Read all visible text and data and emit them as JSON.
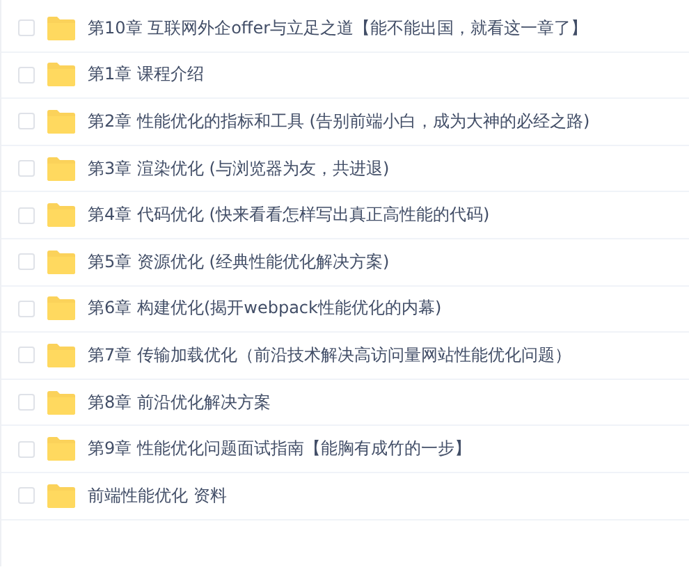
{
  "files": [
    {
      "name": "第10章 互联网外企offer与立足之道【能不能出国，就看这一章了】",
      "checked": false
    },
    {
      "name": "第1章 课程介绍",
      "checked": false
    },
    {
      "name": "第2章 性能优化的指标和工具 (告别前端小白，成为大神的必经之路)",
      "checked": false
    },
    {
      "name": "第3章 渲染优化 (与浏览器为友，共进退)",
      "checked": false
    },
    {
      "name": "第4章 代码优化 (快来看看怎样写出真正高性能的代码)",
      "checked": false
    },
    {
      "name": "第5章 资源优化 (经典性能优化解决方案)",
      "checked": false
    },
    {
      "name": "第6章 构建优化(揭开webpack性能优化的内幕)",
      "checked": false
    },
    {
      "name": "第7章 传输加载优化（前沿技术解决高访问量网站性能优化问题）",
      "checked": false
    },
    {
      "name": "第8章 前沿优化解决方案",
      "checked": false
    },
    {
      "name": "第9章 性能优化问题面试指南【能胸有成竹的一步】",
      "checked": false
    },
    {
      "name": "前端性能优化 资料",
      "checked": false
    }
  ]
}
